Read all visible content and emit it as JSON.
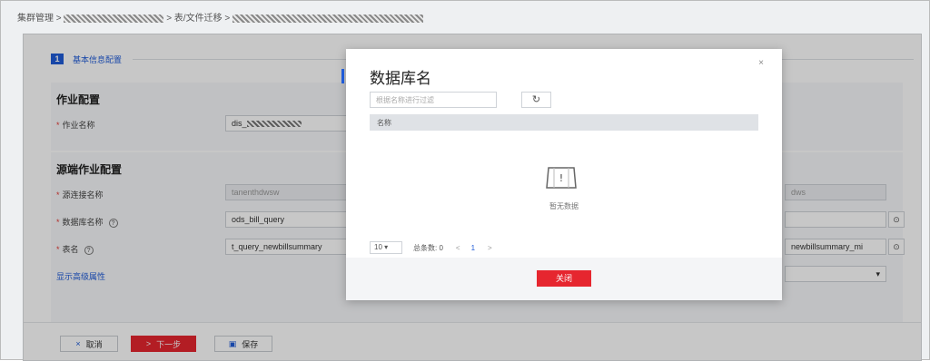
{
  "breadcrumb": {
    "seg1": "集群管理 >",
    "seg2": "> 表/文件迁移 >",
    "redaction": "redacted"
  },
  "step": {
    "number": "1",
    "label": "基本信息配置"
  },
  "job_config": {
    "title": "作业配置",
    "job_name_label": "作业名称",
    "job_name_value": "dis_"
  },
  "source_config": {
    "title": "源端作业配置",
    "link_label": "源连接名称",
    "link_value": "tanenthdwsw",
    "db_label": "数据库名称",
    "db_value": "ods_bill_query",
    "table_label": "表名",
    "table_value": "t_query_newbillsummary",
    "right_link_value": "dws",
    "right_table_value": "newbillsummary_mi",
    "advanced_link": "显示高级属性",
    "help_glyph": "?"
  },
  "footer": {
    "cancel": "取消",
    "next": "下一步",
    "save": "保存",
    "cancel_icon": "×",
    "next_icon": ">",
    "save_icon": "▣"
  },
  "dialog": {
    "title": "数据库名",
    "close_glyph": "×",
    "search_placeholder": "根据名称进行过滤",
    "refresh_glyph": "↻",
    "column_header": "名称",
    "empty_glyph": "!",
    "empty_text": "暂无数据",
    "page_size": "10 ▾",
    "total": "总条数: 0",
    "prev": "<",
    "page": "1",
    "next": ">",
    "close_button": "关闭"
  },
  "glyphs": {
    "target": "⊙",
    "dropdown": "▾",
    "ellipsis": "…"
  },
  "colors": {
    "primary_red": "#e6262f",
    "accent_blue": "#1f5bd8"
  }
}
